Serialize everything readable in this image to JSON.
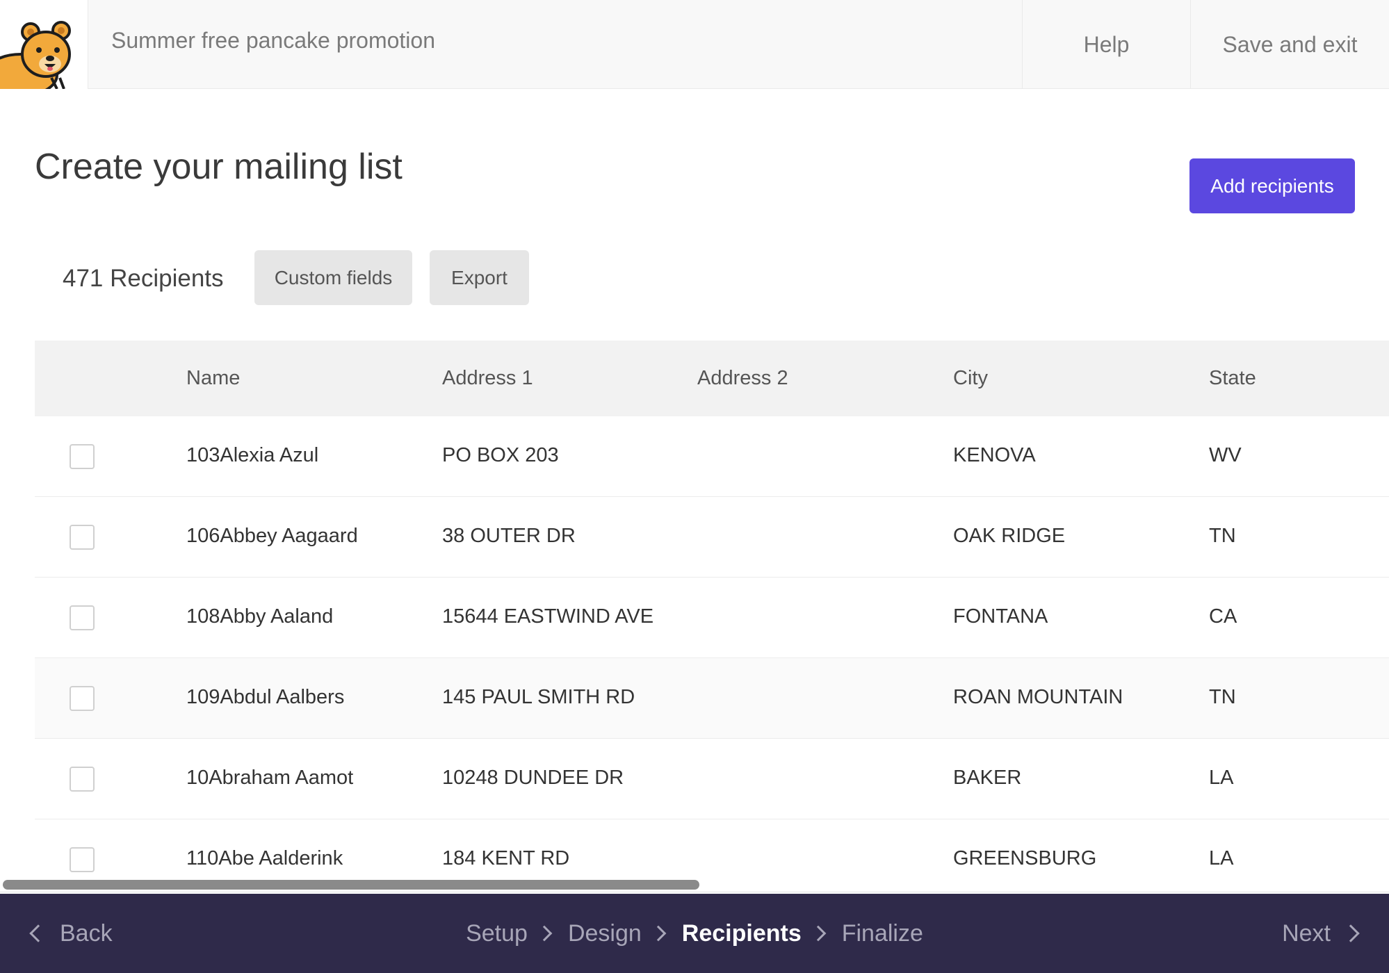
{
  "header": {
    "campaign_title": "Summer free pancake promotion",
    "help_label": "Help",
    "save_exit_label": "Save and exit"
  },
  "main": {
    "title": "Create your mailing list",
    "add_recipients_label": "Add recipients",
    "recipient_count": "471 Recipients",
    "custom_fields_label": "Custom fields",
    "export_label": "Export"
  },
  "table": {
    "columns": {
      "name": "Name",
      "address1": "Address 1",
      "address2": "Address 2",
      "city": "City",
      "state": "State"
    },
    "rows": [
      {
        "name": "103Alexia Azul",
        "address1": "PO BOX 203",
        "address2": "",
        "city": "KENOVA",
        "state": "WV"
      },
      {
        "name": "106Abbey Aagaard",
        "address1": "38 OUTER DR",
        "address2": "",
        "city": "OAK RIDGE",
        "state": "TN"
      },
      {
        "name": "108Abby Aaland",
        "address1": "15644 EASTWIND AVE",
        "address2": "",
        "city": "FONTANA",
        "state": "CA"
      },
      {
        "name": "109Abdul Aalbers",
        "address1": "145 PAUL SMITH RD",
        "address2": "",
        "city": "ROAN MOUNTAIN",
        "state": "TN"
      },
      {
        "name": "10Abraham Aamot",
        "address1": "10248 DUNDEE DR",
        "address2": "",
        "city": "BAKER",
        "state": "LA"
      },
      {
        "name": "110Abe Aalderink",
        "address1": "184 KENT RD",
        "address2": "",
        "city": "GREENSBURG",
        "state": "LA"
      }
    ]
  },
  "footer": {
    "back_label": "Back",
    "next_label": "Next",
    "steps": [
      "Setup",
      "Design",
      "Recipients",
      "Finalize"
    ],
    "active_step": "Recipients"
  },
  "colors": {
    "accent": "#5b48e0",
    "footer_bg": "#2f2a4a",
    "logo_fur": "#f2a93b"
  },
  "icons": {
    "logo": "quokka-mascot-logo",
    "back": "chevron-left-icon",
    "next": "chevron-right-icon",
    "step_separator": "chevron-right-icon"
  }
}
